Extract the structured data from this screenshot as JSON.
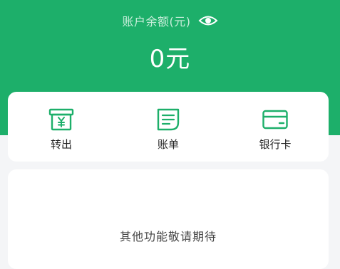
{
  "balance": {
    "label": "账户余额(元)",
    "amount": "0元",
    "visibility_icon": "eye-icon"
  },
  "actions": [
    {
      "label": "转出",
      "icon": "transfer-out-icon"
    },
    {
      "label": "账单",
      "icon": "bill-icon"
    },
    {
      "label": "银行卡",
      "icon": "bank-card-icon"
    }
  ],
  "info": {
    "text": "其他功能敬请期待"
  },
  "colors": {
    "brand_green": "#1daf6a",
    "page_background": "#f4f5f7",
    "card_background": "#ffffff"
  }
}
